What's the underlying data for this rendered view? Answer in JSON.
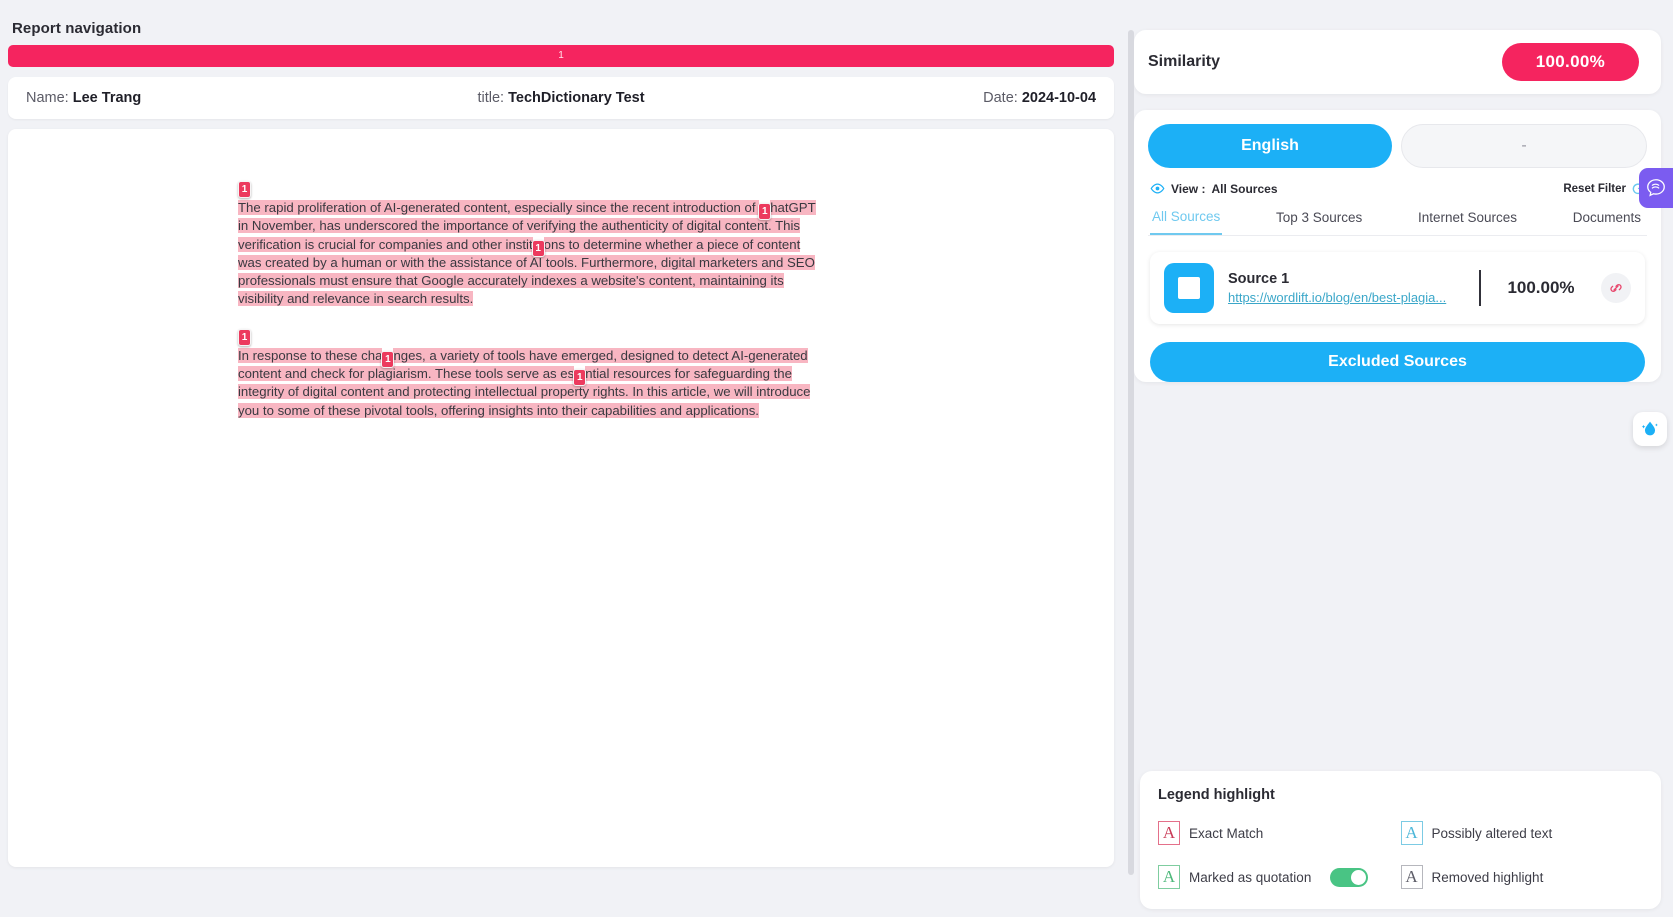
{
  "report_nav": {
    "title": "Report navigation",
    "bar_marker": "1",
    "bar_color": "#f5245f"
  },
  "meta": {
    "name_label": "Name:",
    "name_value": "Lee Trang",
    "title_label": "title:",
    "title_value": "TechDictionary Test",
    "date_label": "Date:",
    "date_value": "2024-10-04"
  },
  "document": {
    "paragraphs": [
      {
        "badge": "1",
        "segments": [
          {
            "type": "hl",
            "text": "The rapid proliferation of AI-generated content, especially since the recent introduction of "
          },
          {
            "type": "badge",
            "text": "1"
          },
          {
            "type": "hl",
            "text": "hatGPT in November, has underscored the importance of verifying the authenticity of digital content. This verification is crucial for companies and other instit"
          },
          {
            "type": "badge",
            "text": "1"
          },
          {
            "type": "hl",
            "text": "ons to determine whether a piece of content was created by a human or with the assistance of AI tools. Furthermore, digital marketers and SEO professionals must ensure that Google accurately indexes a website's content, maintaining its visibility and relevance in search results."
          }
        ]
      },
      {
        "badge": "1",
        "segments": [
          {
            "type": "hl",
            "text": "In response to these cha"
          },
          {
            "type": "badge",
            "text": "1"
          },
          {
            "type": "hl",
            "text": "nges, a variety of tools have emerged, designed to detect AI-generated content and check for plagiarism. These tools serve as es"
          },
          {
            "type": "badge",
            "text": "1"
          },
          {
            "type": "hl",
            "text": "ntial resources for safeguarding the integrity of digital content and protecting intellectual property rights. In this article, we will introduce you to some of these pivotal tools, offering insights into their capabilities and applications."
          }
        ]
      }
    ]
  },
  "similarity": {
    "label": "Similarity",
    "value": "100.00%",
    "color": "#f5245f"
  },
  "sources_panel": {
    "language_tabs": [
      {
        "label": "English",
        "active": true
      },
      {
        "label": "-",
        "active": false
      }
    ],
    "view_label": "View :",
    "view_value": "All Sources",
    "reset_filter": "Reset Filter",
    "tabs": [
      {
        "label": "All Sources",
        "active": true
      },
      {
        "label": "Top 3 Sources",
        "active": false
      },
      {
        "label": "Internet Sources",
        "active": false
      },
      {
        "label": "Documents",
        "active": false
      }
    ],
    "sources": [
      {
        "title": "Source 1",
        "url": "https://wordlift.io/blog/en/best-plagia...",
        "percent": "100.00%"
      }
    ],
    "excluded_button": "Excluded Sources",
    "accent_color": "#1cb0f6"
  },
  "legend": {
    "title": "Legend highlight",
    "items": [
      {
        "glyph": "A",
        "label": "Exact Match",
        "swatch": "red",
        "toggle": false
      },
      {
        "glyph": "A",
        "label": "Possibly altered text",
        "swatch": "cyan",
        "toggle": false
      },
      {
        "glyph": "A",
        "label": "Marked as quotation",
        "swatch": "green",
        "toggle": true
      },
      {
        "glyph": "A",
        "label": "Removed highlight",
        "swatch": "grey",
        "toggle": false
      }
    ]
  },
  "floating": {
    "chat_icon": "chat-bubble-icon",
    "water_icon": "water-drop-icon"
  }
}
